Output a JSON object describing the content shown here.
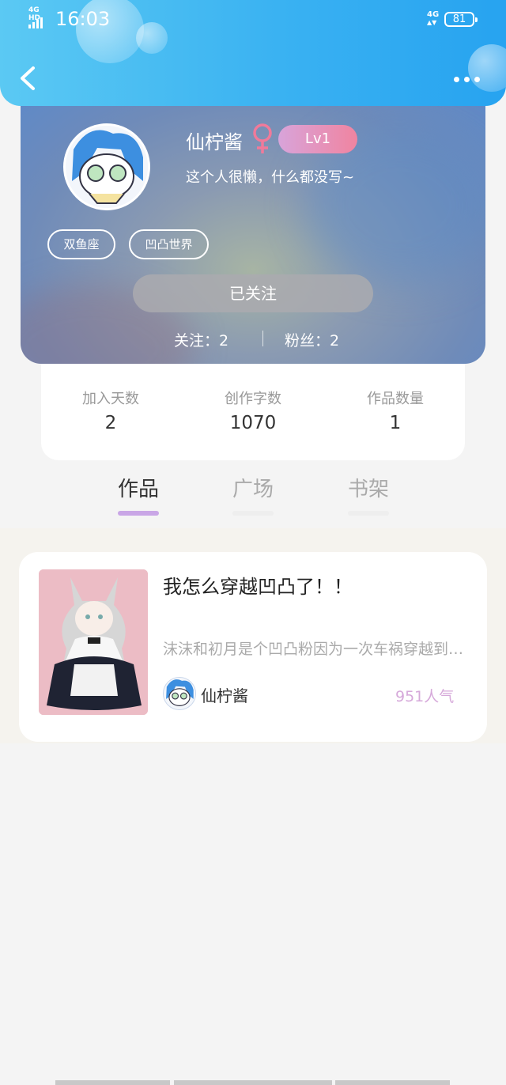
{
  "status_bar": {
    "time": "16:03",
    "network": "4G",
    "network_hd": "4G HD",
    "battery": "81"
  },
  "profile": {
    "nickname": "仙柠酱",
    "level": "Lv1",
    "signature": "这个人很懒，什么都没写~",
    "tags": [
      "双鱼座",
      "凹凸世界"
    ],
    "follow_button": "已关注",
    "following": "关注：2",
    "fans": "粉丝：2"
  },
  "stats": [
    {
      "label": "加入天数",
      "value": "2"
    },
    {
      "label": "创作字数",
      "value": "1070"
    },
    {
      "label": "作品数量",
      "value": "1"
    }
  ],
  "tabs": [
    {
      "label": "作品",
      "active": true
    },
    {
      "label": "广场",
      "active": false
    },
    {
      "label": "书架",
      "active": false
    }
  ],
  "works": [
    {
      "title": "我怎么穿越凹凸了！！",
      "description": "沫沫和初月是个凹凸粉因为一次车祸穿越到凹凸世界",
      "author": "仙柠酱",
      "popularity": "951人气"
    }
  ],
  "colors": {
    "topbar": "#3ab2f2",
    "accent_purple": "#c9a6e6",
    "gender_pink": "#f07a9a",
    "popularity": "#d6a9da"
  },
  "icons": {
    "back": "chevron-left-icon",
    "more": "more-dots-icon",
    "gender": "female-icon"
  }
}
